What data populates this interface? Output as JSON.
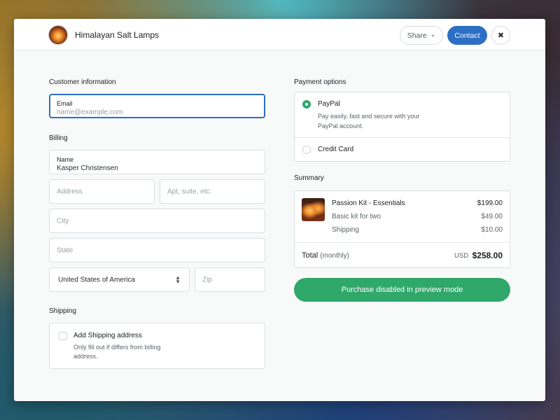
{
  "header": {
    "store_name": "Himalayan Salt Lamps",
    "share_label": "Share",
    "contact_label": "Contact",
    "close_glyph": "✖"
  },
  "customer": {
    "title": "Customer information",
    "email_label": "Email",
    "email_placeholder": "name@example.com"
  },
  "billing": {
    "title": "Billing",
    "name_label": "Name",
    "name_value": "Kasper Christensen",
    "address_placeholder": "Address",
    "apt_placeholder": "Apt, suite, etc.",
    "city_placeholder": "City",
    "state_placeholder": "State",
    "country_value": "United States of America",
    "zip_placeholder": "Zip"
  },
  "shipping": {
    "title": "Shipping",
    "checkbox_label": "Add Shipping address",
    "checkbox_desc": "Only fill out if differs from billing address.",
    "checked": false
  },
  "payment": {
    "title": "Payment options",
    "options": [
      {
        "name": "PayPal",
        "desc": "Pay easily, fast and secure with your PayPal account.",
        "selected": true
      },
      {
        "name": "Credit Card",
        "desc": "",
        "selected": false
      }
    ]
  },
  "summary": {
    "title": "Summary",
    "item_name": "Passion Kit - Essentials",
    "item_price": "$199.00",
    "lines": [
      {
        "label": "Basic kit for two",
        "price": "$49.00"
      },
      {
        "label": "Shipping",
        "price": "$10.00"
      }
    ],
    "total_label": "Total",
    "total_period": "(monthly)",
    "currency": "USD",
    "total_amount": "$258.00"
  },
  "purchase_label": "Purchase disabled in preview mode",
  "colors": {
    "primary": "#2d6fc4",
    "success": "#2fa86a"
  },
  "icons": {
    "logo": "salt-lamp-logo-icon",
    "share_chevron": "chevron-down-icon",
    "close": "close-icon",
    "select": "select-arrows-icon"
  }
}
